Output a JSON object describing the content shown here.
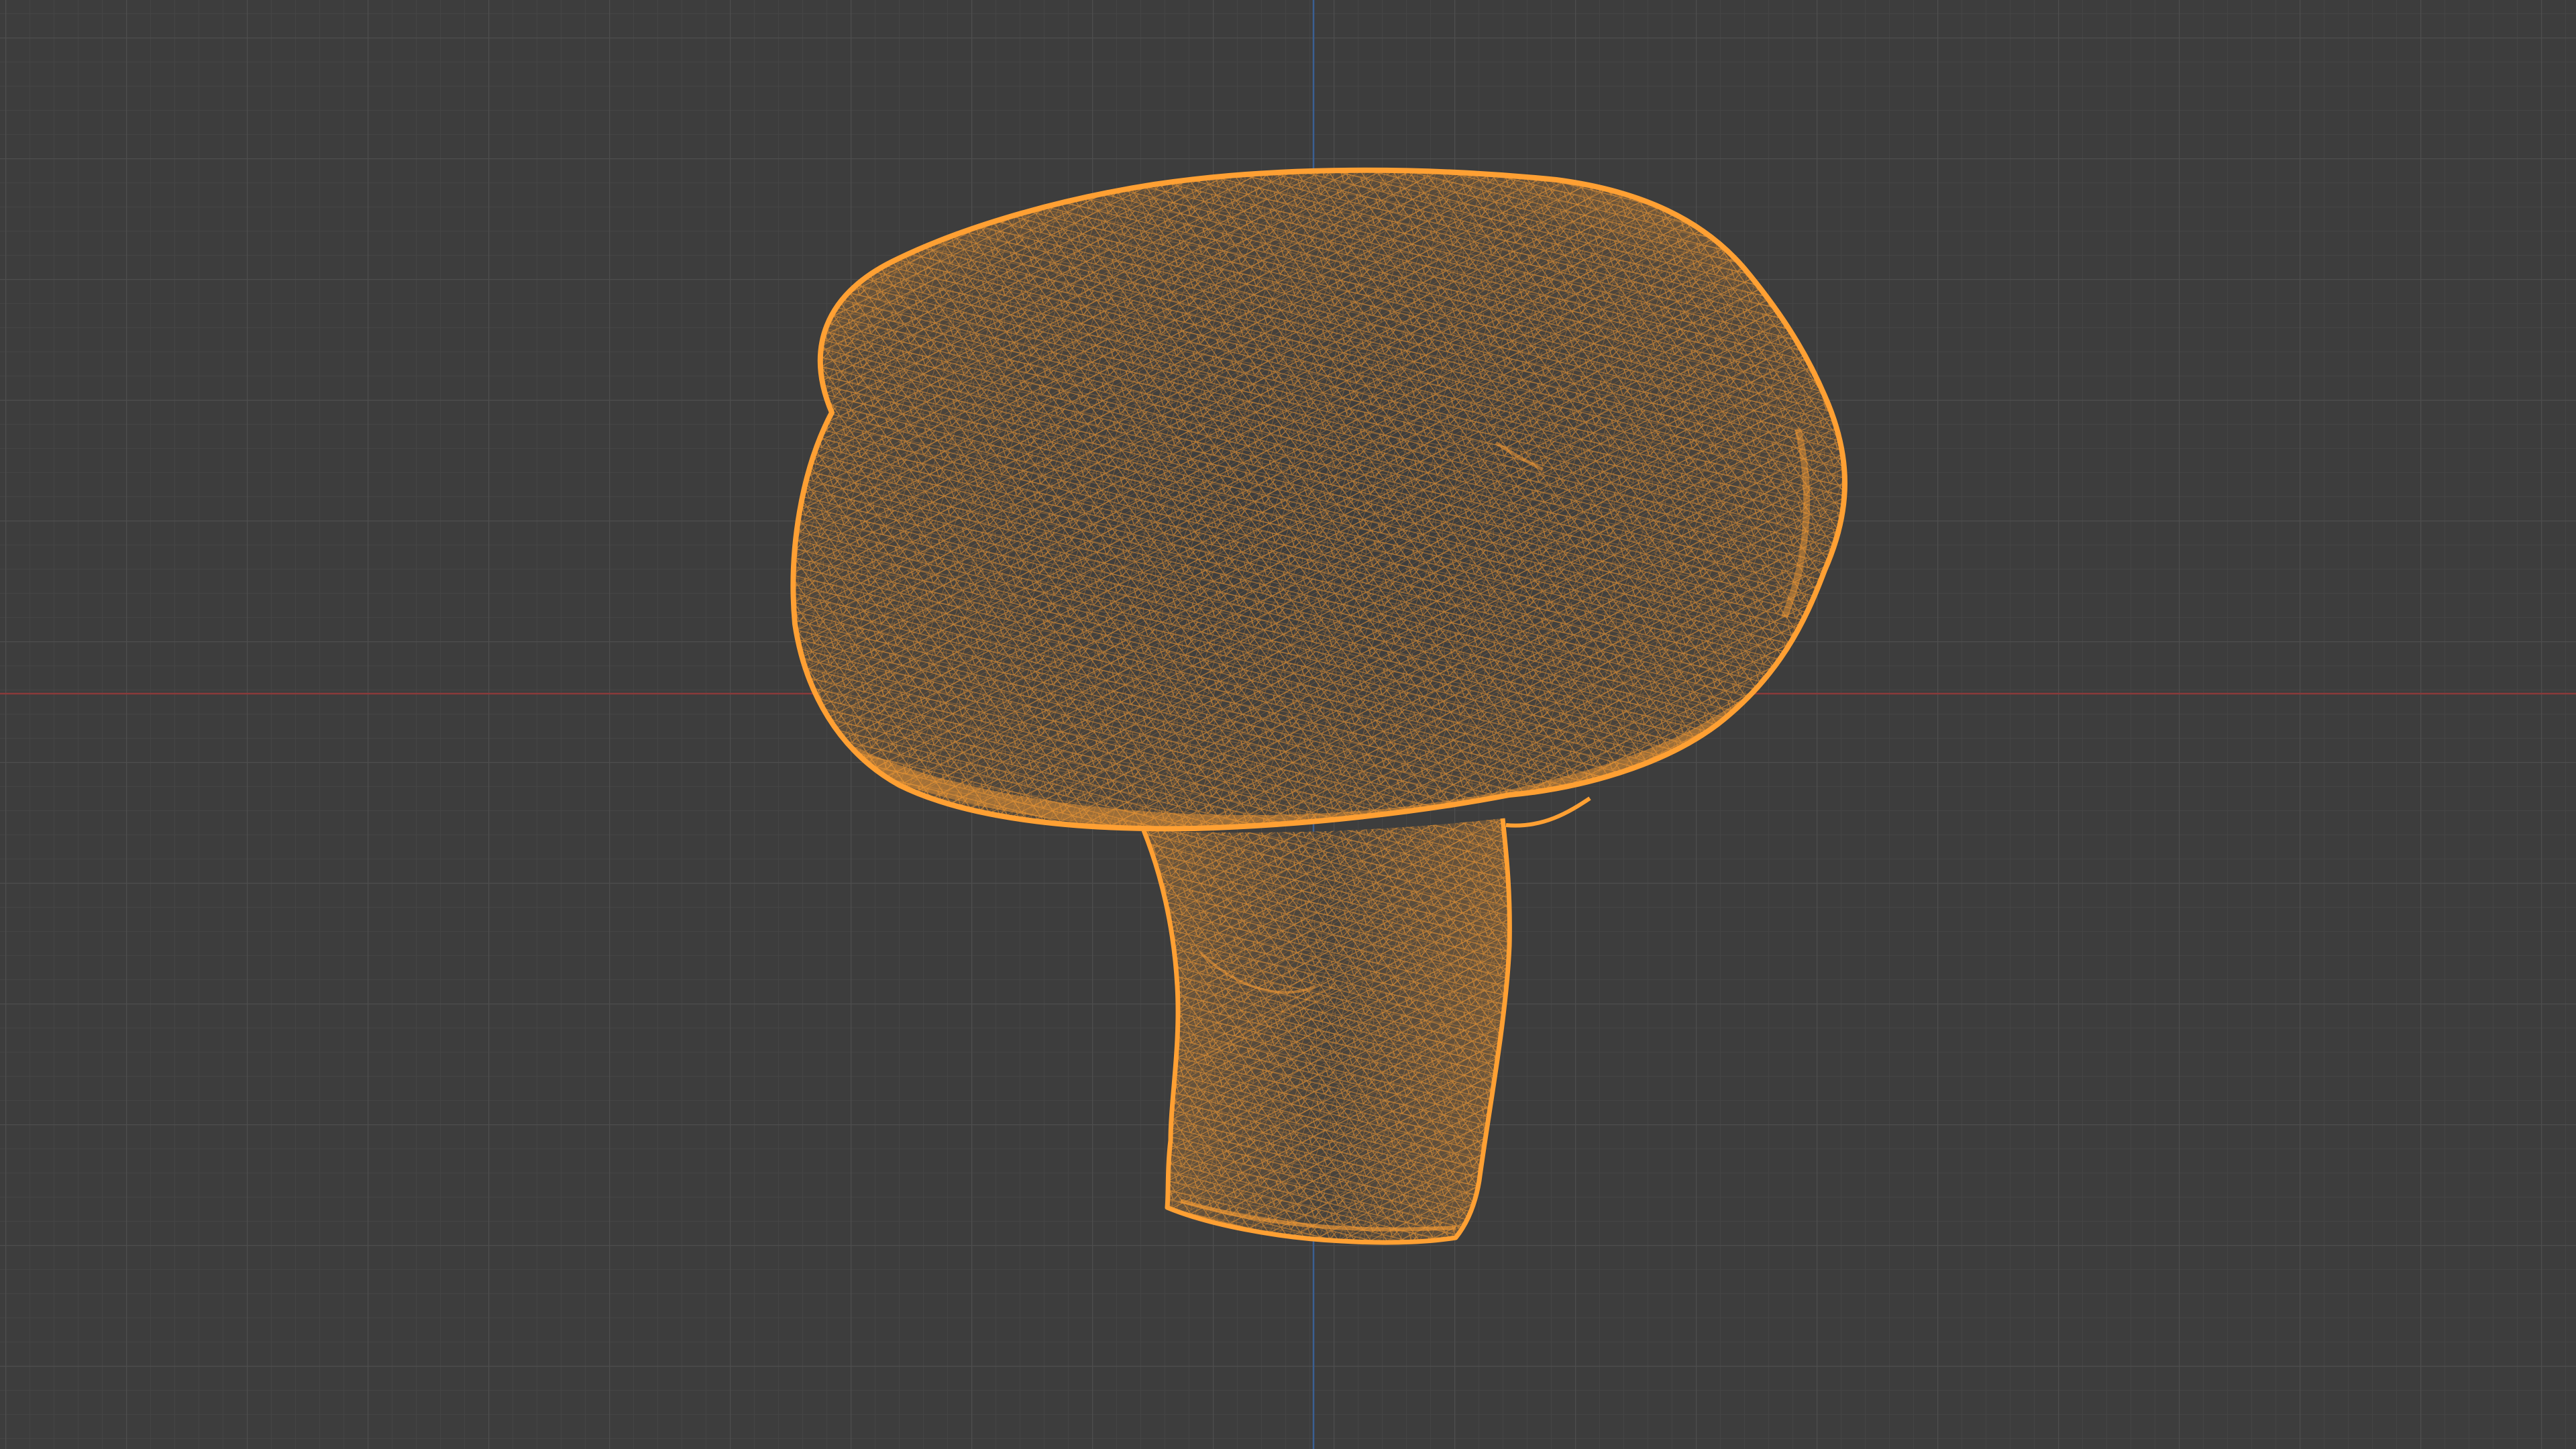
{
  "viewport": {
    "background_color": "#3d3d3d",
    "grid_minor_color": "#454545",
    "grid_major_color": "#4e4e4e",
    "x_axis_color": "#8a3a3a",
    "z_axis_color": "#3a5f92",
    "wireframe_color": "#ffa033",
    "shading_mode": "wireframe",
    "object": {
      "name": "mushroom",
      "selected": true
    }
  }
}
